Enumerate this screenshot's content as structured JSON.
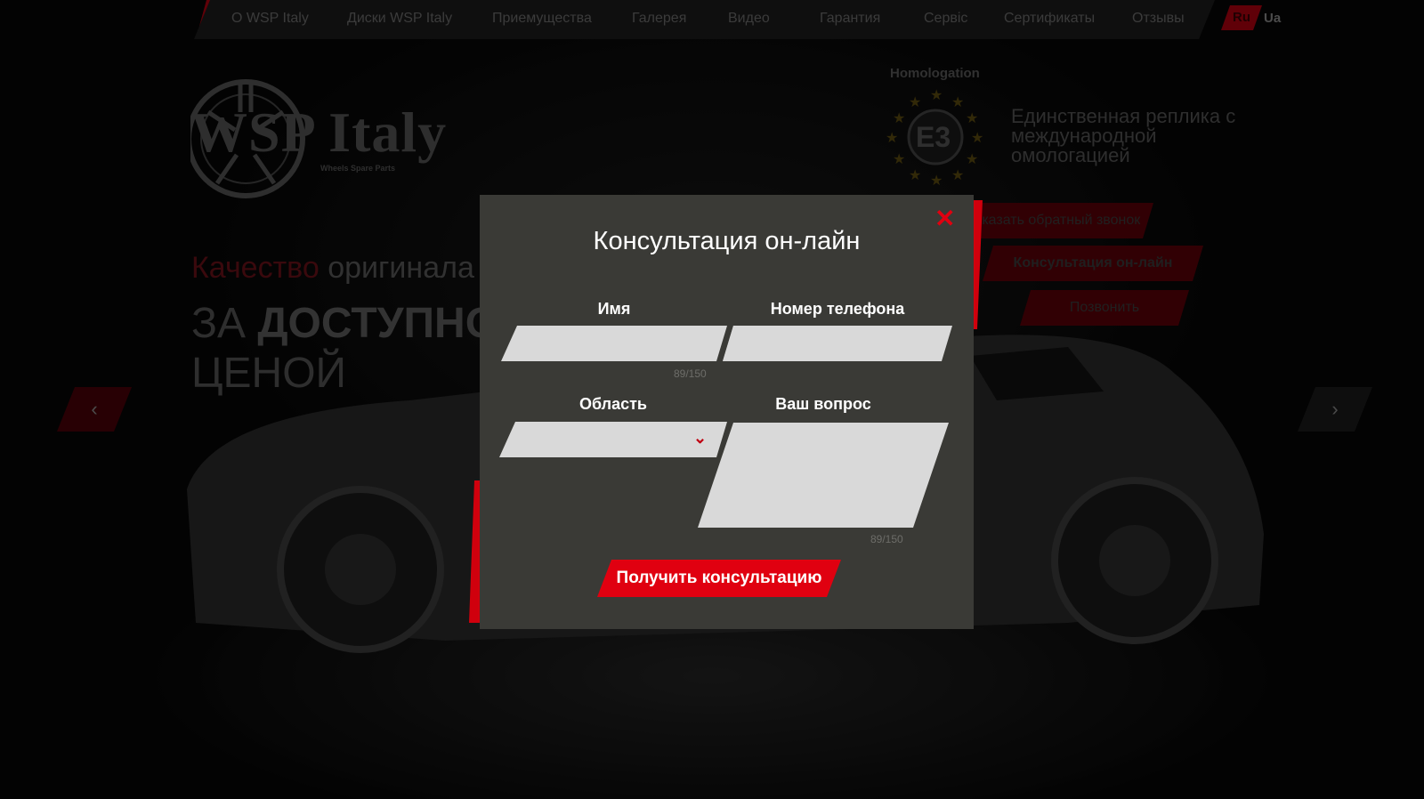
{
  "nav": {
    "items": [
      "О WSP Italy",
      "Диски WSP Italy",
      "Приемущества",
      "Галерея",
      "Видео",
      "Гарантия",
      "Сервіс",
      "Сертификаты",
      "Отзывы"
    ],
    "lang_ru": "Ru",
    "lang_ua": "Ua"
  },
  "brand": {
    "logo_text": "WSP Italy",
    "logo_sub": "Wheels Spare Parts"
  },
  "hero": {
    "line1_red": "Качество",
    "line1_rest": " оригинала",
    "line2_light": "ЗА ",
    "line2_bold": "ДОСТУПНОЙ",
    "line3": "ЦЕНОЙ"
  },
  "homologation": {
    "title": "Homologation",
    "badge": "E3",
    "text": "Единственная реплика с международной омологацией"
  },
  "side_buttons": {
    "callback": "Заказать обратный звонок",
    "consult": "Консультация он-лайн",
    "call": "Позвонить"
  },
  "modal": {
    "title": "Консультация он-лайн",
    "name_label": "Имя",
    "name_value": "",
    "name_counter": "89/150",
    "phone_label": "Номер телефона",
    "phone_value": "",
    "region_label": "Область",
    "region_value": "",
    "question_label": "Ваш вопрос",
    "question_value": "",
    "question_counter": "89/150",
    "submit_label": "Получить консультацию",
    "close_icon": "close-icon"
  },
  "colors": {
    "accent": "#e00010",
    "modal_bg": "#3a3a36",
    "field_bg": "#d9d9d9"
  }
}
